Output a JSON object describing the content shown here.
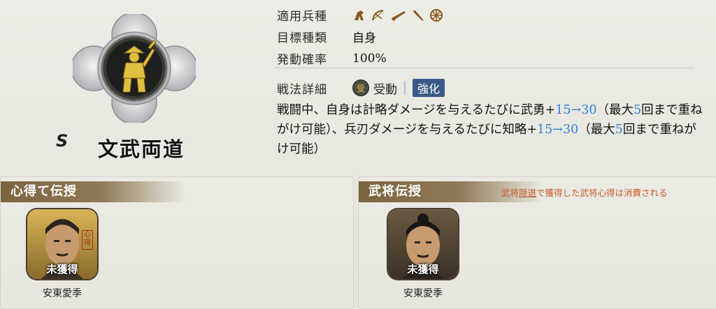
{
  "skill": {
    "grade": "S",
    "name": "文武両道"
  },
  "info": [
    {
      "label": "適用兵種",
      "type": "icons",
      "icons": [
        "cavalry-icon",
        "bow-icon",
        "gun-icon",
        "spear-icon",
        "siege-wheel-icon"
      ]
    },
    {
      "label": "目標種類",
      "value": "自身"
    },
    {
      "label": "発動確率",
      "value": "100%"
    }
  ],
  "detail": {
    "label": "戦法詳細",
    "passive_icon": "受",
    "passive": "受動",
    "enhanced": "強化",
    "text_parts": [
      {
        "t": "戦闘中、自身は計略ダメージを与えるたびに武勇+"
      },
      {
        "t": "15→30",
        "hl": true
      },
      {
        "t": "（最大"
      },
      {
        "t": "5",
        "hl": true
      },
      {
        "t": "回まで重ねがけ可能）、兵刃ダメージを与えるたびに知略+"
      },
      {
        "t": "15→30",
        "hl": true
      },
      {
        "t": "（最大"
      },
      {
        "t": "5",
        "hl": true
      },
      {
        "t": "回まで重ねがけ可能）"
      }
    ]
  },
  "panels": {
    "left": {
      "title": "心得て伝授",
      "hero": {
        "name": "安東愛季",
        "status": "未獲得",
        "badge": "心得"
      }
    },
    "right": {
      "title": "武将伝授",
      "note_pre": "武将",
      "note_link": "隠退",
      "note_post": "で獲得した武将心得は消費される",
      "hero": {
        "name": "安東愛季",
        "status": "未獲得"
      }
    }
  },
  "colors": {
    "highlight": "#2e7fd8",
    "enhance_bg": "#3c5a88",
    "title_bar": "#7c6440",
    "note": "#c85a2a"
  }
}
